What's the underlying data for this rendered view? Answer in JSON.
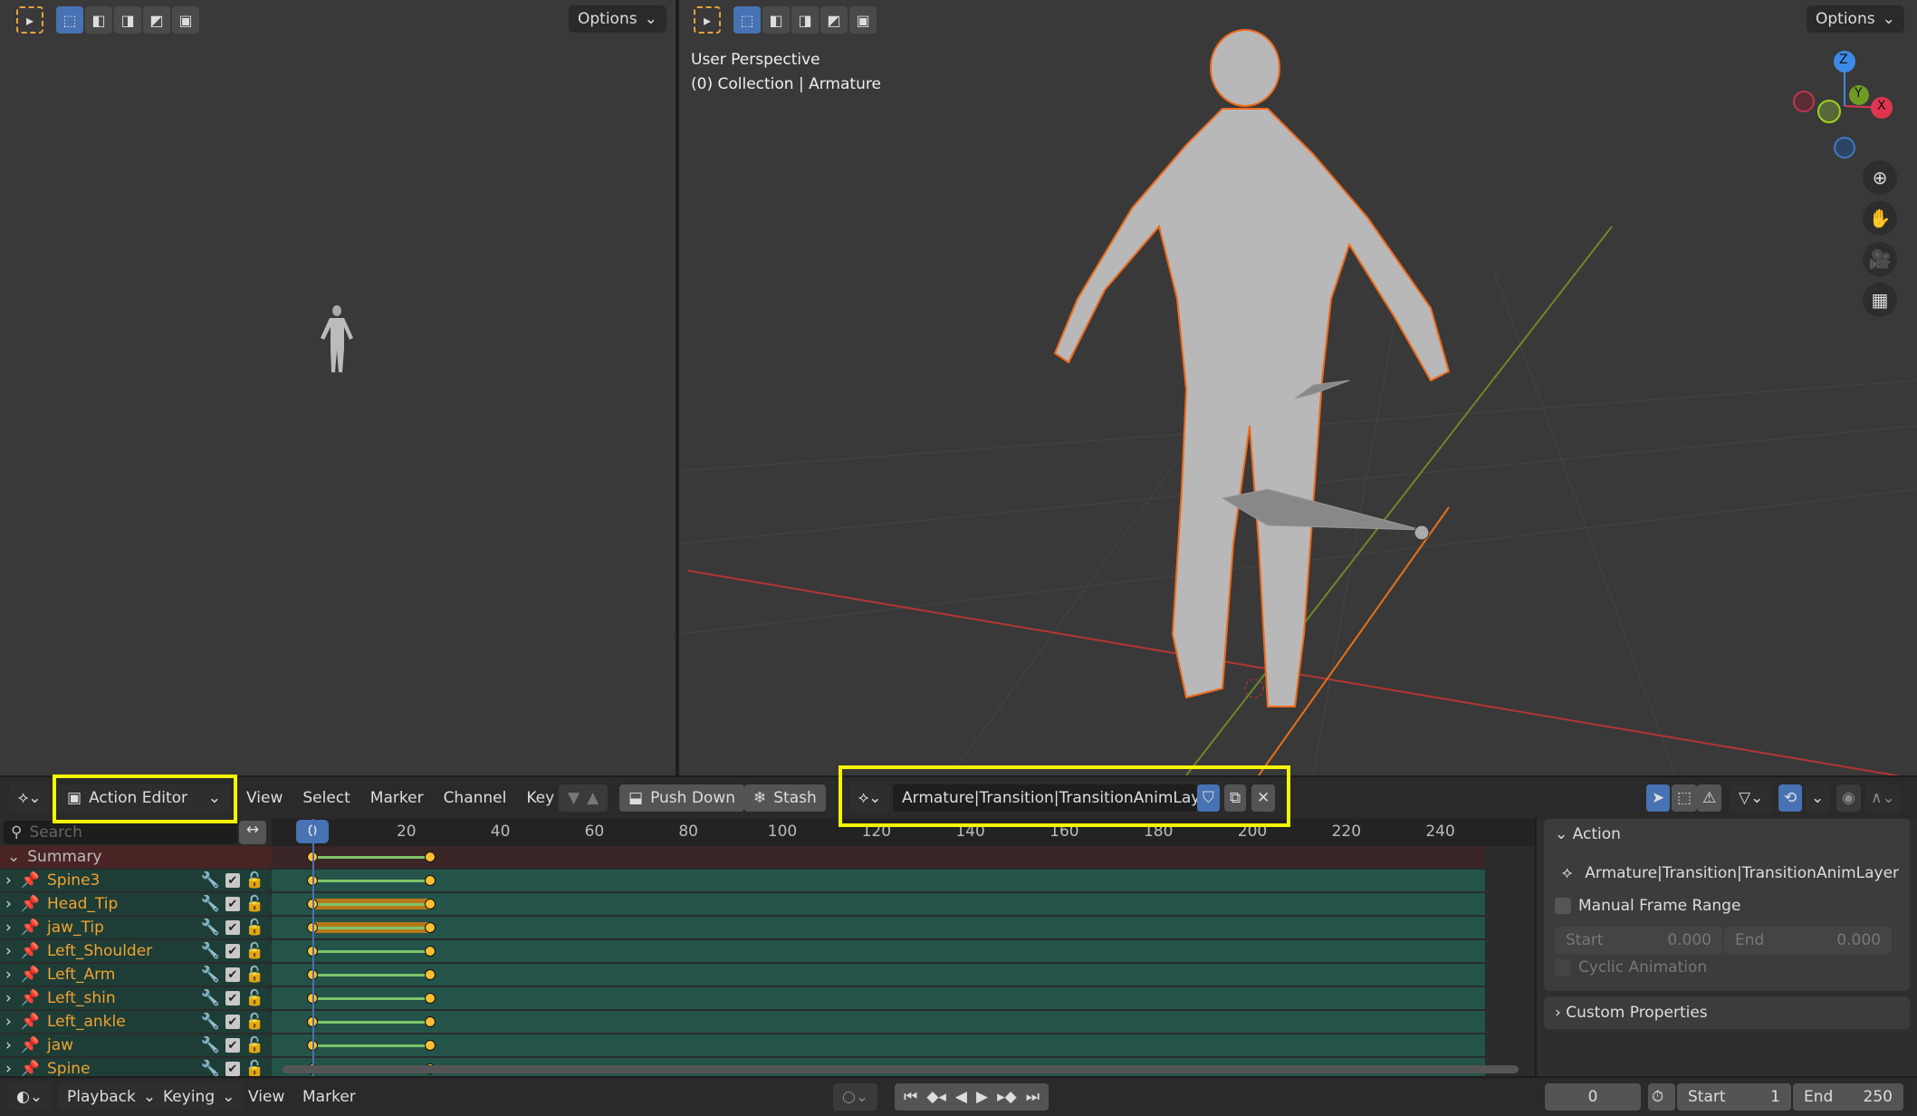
{
  "viewport_left": {
    "options_label": "Options"
  },
  "viewport_right": {
    "options_label": "Options",
    "view_name": "User Perspective",
    "collection_info": "(0) Collection | Armature",
    "gizmo_axes": [
      "Z",
      "Y",
      "X"
    ]
  },
  "dopesheet": {
    "mode": "Action Editor",
    "menus": [
      "View",
      "Select",
      "Marker",
      "Channel",
      "Key"
    ],
    "push_down": "Push Down",
    "stash": "Stash",
    "action_name": "Armature|Transition|TransitionAnimLayer",
    "search_placeholder": "Search",
    "current_frame": "0",
    "ruler_ticks": [
      "20",
      "40",
      "60",
      "80",
      "100",
      "120",
      "140",
      "160",
      "180",
      "200",
      "220",
      "240"
    ],
    "summary_label": "Summary",
    "keyframes": [
      0,
      25
    ],
    "channels": [
      {
        "name": "Spine3",
        "hold": false
      },
      {
        "name": "Head_Tip",
        "hold": true
      },
      {
        "name": "jaw_Tip",
        "hold": true
      },
      {
        "name": "Left_Shoulder",
        "hold": false
      },
      {
        "name": "Left_Arm",
        "hold": false
      },
      {
        "name": "Left_shin",
        "hold": false
      },
      {
        "name": "Left_ankle",
        "hold": false
      },
      {
        "name": "jaw",
        "hold": false
      },
      {
        "name": "Spine",
        "hold": false
      }
    ],
    "colors": {
      "selected": "#4772b3",
      "channel_name": "#f0a330",
      "keyframe": "#ffbe33",
      "highlight": "#f5f500"
    }
  },
  "sidebar": {
    "action_panel": "Action",
    "action_name": "Armature|Transition|TransitionAnimLayer",
    "manual_frame_range": "Manual Frame Range",
    "start_label": "Start",
    "start_value": "0.000",
    "end_label": "End",
    "end_value": "0.000",
    "cyclic": "Cyclic Animation",
    "custom_props": "Custom Properties"
  },
  "timeline": {
    "menus": [
      "Playback",
      "Keying",
      "View",
      "Marker"
    ],
    "current_frame": "0",
    "start_label": "Start",
    "start": "1",
    "end_label": "End",
    "end": "250"
  }
}
